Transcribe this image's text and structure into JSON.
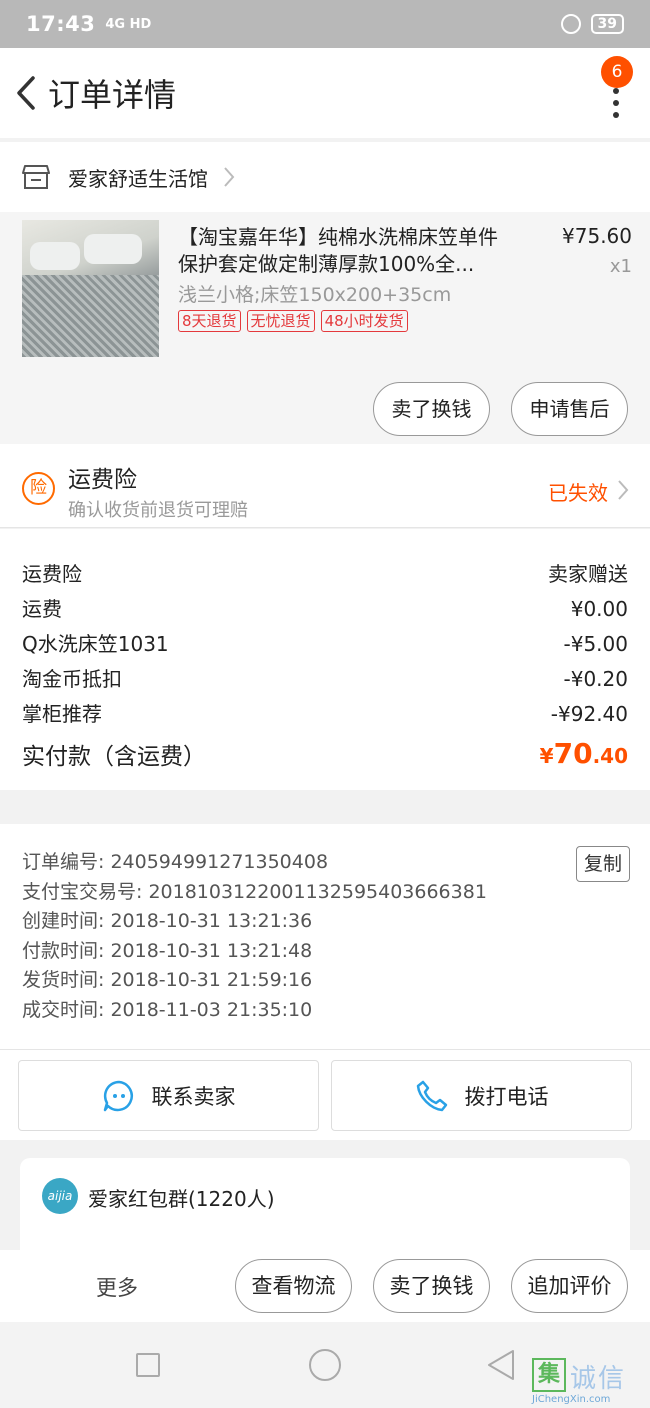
{
  "status_bar": {
    "time": "17:43",
    "signal": "4G HD",
    "battery": "39"
  },
  "nav": {
    "title": "订单详情",
    "badge_count": "6"
  },
  "shop": {
    "name": "爱家舒适生活馆"
  },
  "product": {
    "title": "【淘宝嘉年华】纯棉水洗棉床笠单件保护套定做定制薄厚款100%全...",
    "sku": "浅兰小格;床笠150x200+35cm",
    "tags": [
      "8天退货",
      "无忧退货",
      "48小时发货"
    ],
    "price": "¥75.60",
    "qty": "x1",
    "btn_exchange": "卖了换钱",
    "btn_aftersale": "申请售后"
  },
  "insurance": {
    "icon_char": "险",
    "title": "运费险",
    "subtitle": "确认收货前退货可理赔",
    "status": "已失效"
  },
  "costs": [
    {
      "label": "运费险",
      "value": "卖家赠送"
    },
    {
      "label": "运费",
      "value": "¥0.00"
    },
    {
      "label": "Q水洗床笠1031",
      "value": "-¥5.00"
    },
    {
      "label": "淘金币抵扣",
      "value": "-¥0.20"
    },
    {
      "label": "掌柜推荐",
      "value": "-¥92.40"
    }
  ],
  "total": {
    "label": "实付款（含运费）",
    "currency": "¥",
    "integer": "70",
    "decimal": ".40"
  },
  "order_info": {
    "order_no": "订单编号: 240594991271350408",
    "alipay_no": "支付宝交易号: 2018103122001132595403666381",
    "created": "创建时间: 2018-10-31 13:21:36",
    "paid": "付款时间: 2018-10-31 13:21:48",
    "shipped": "发货时间: 2018-10-31 21:59:16",
    "completed": "成交时间: 2018-11-03 21:35:10",
    "copy_label": "复制"
  },
  "contact": {
    "seller": "联系卖家",
    "phone": "拨打电话"
  },
  "group": {
    "avatar_text": "aijia",
    "name": "爱家红包群(1220人)"
  },
  "bottom_bar": {
    "more": "更多",
    "logistics": "查看物流",
    "exchange": "卖了换钱",
    "review": "追加评价"
  },
  "watermark": {
    "char": "集",
    "text": "诚信",
    "url": "JiChengXin.com"
  },
  "colors": {
    "accent": "#ff5000",
    "tag_red": "#e4393c",
    "blue_icon": "#29a1e6"
  }
}
